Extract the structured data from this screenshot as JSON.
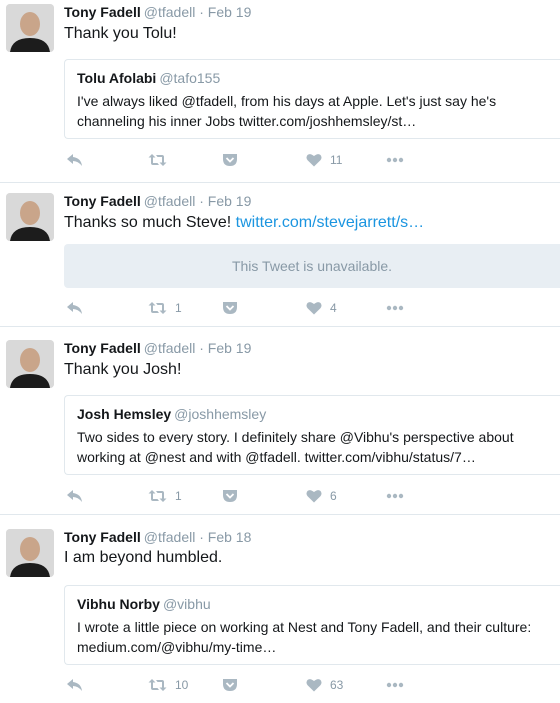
{
  "colors": {
    "link": "#1b95e0",
    "muted": "#8899a6",
    "icon": "#aab8c2",
    "border": "#e1e8ed"
  },
  "tweets": [
    {
      "name": "Tony Fadell",
      "handle": "@tfadell",
      "sep": "·",
      "date": "Feb 19",
      "text": "Thank you Tolu!",
      "quote": {
        "name": "Tolu Afolabi",
        "handle": "@tafo155",
        "body": "I've always liked @tfadell, from his days at Apple. Let's just say he's channeling his inner Jobs  twitter.com/joshhemsley/st…"
      },
      "actions": {
        "reply_icon": "reply-icon",
        "retweets": "",
        "pocket_icon": "pocket-icon",
        "likes": "11",
        "more_icon": "more-icon"
      }
    },
    {
      "name": "Tony Fadell",
      "handle": "@tfadell",
      "sep": "·",
      "date": "Feb 19",
      "text": "Thanks so much Steve! ",
      "link": "twitter.com/stevejarrett/s…",
      "unavailable": "This Tweet is unavailable.",
      "actions": {
        "retweets": "1",
        "likes": "4"
      }
    },
    {
      "name": "Tony Fadell",
      "handle": "@tfadell",
      "sep": "·",
      "date": "Feb 19",
      "text": "Thank you Josh!",
      "quote": {
        "name": "Josh Hemsley",
        "handle": "@joshhemsley",
        "body": "Two sides to every story. I definitely share @Vibhu's perspective about working at @nest and with @tfadell. twitter.com/vibhu/status/7…"
      },
      "actions": {
        "retweets": "1",
        "likes": "6"
      }
    },
    {
      "name": "Tony Fadell",
      "handle": "@tfadell",
      "sep": "·",
      "date": "Feb 18",
      "text": "I am beyond humbled.",
      "quote": {
        "name": "Vibhu Norby",
        "handle": "@vibhu",
        "body": "I wrote a little piece on working at Nest and Tony Fadell, and their culture: medium.com/@vibhu/my-time…"
      },
      "actions": {
        "retweets": "10",
        "likes": "63"
      }
    }
  ]
}
